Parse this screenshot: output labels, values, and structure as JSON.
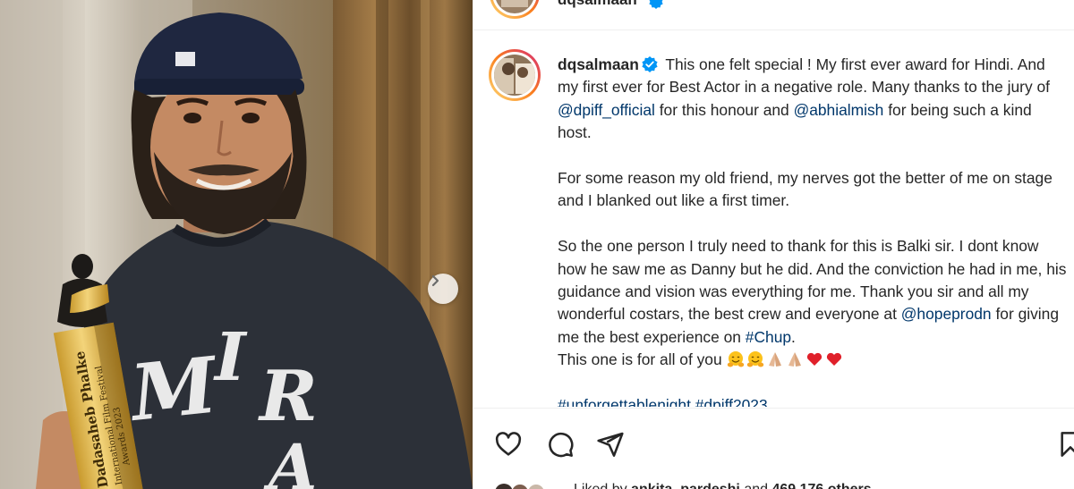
{
  "post": {
    "username": "dqsalmaan",
    "verified": true,
    "caption_intro": " This one felt special ! My first ever award for Hindi. And my first ever for Best Actor in a negative role. Many thanks to the jury of ",
    "mention_1": "@dpiff_official",
    "caption_2": " for this honour and ",
    "mention_2": "@abhialmish",
    "caption_3": " for being such a kind host.\n\nFor some reason my old friend, my nerves got the better of me on stage and I blanked out like a first timer.\n\nSo the one person I truly need to thank for this is Balki sir. I dont know how he saw me as Danny but he did. And the conviction he had in me, his guidance and vision was everything for me. Thank you sir and all my wonderful costars, the best crew and everyone at ",
    "mention_3": "@hopeprodn",
    "caption_4": " for giving me the best experience on ",
    "hashtag_1": "#Chup",
    "caption_5": ".\nThis one is for all of you ",
    "hashtags_line": "#unforgettablenight #dpiff2023",
    "emojis": [
      "hugging-face",
      "hugging-face",
      "folded-hands",
      "folded-hands",
      "red-heart",
      "red-heart"
    ]
  },
  "photo": {
    "trophy_text_1": "Dadasaheb Phalke",
    "trophy_text_2": "International Film Festival",
    "trophy_text_3": "Awards 2023",
    "sweatshirt_letters": "M I R A"
  },
  "likes": {
    "prefix": "Liked by ",
    "user": "ankita_pardeshi",
    "middle": " and ",
    "count": "469,176 others"
  },
  "icons": [
    "like-icon",
    "comment-icon",
    "share-icon",
    "save-icon",
    "verified-badge-icon",
    "carousel-next-icon"
  ],
  "colors": {
    "link": "#00376b",
    "text": "#262626",
    "verified": "#0095f6",
    "story_ring_start": "#feda75",
    "story_ring_end": "#d62976"
  }
}
